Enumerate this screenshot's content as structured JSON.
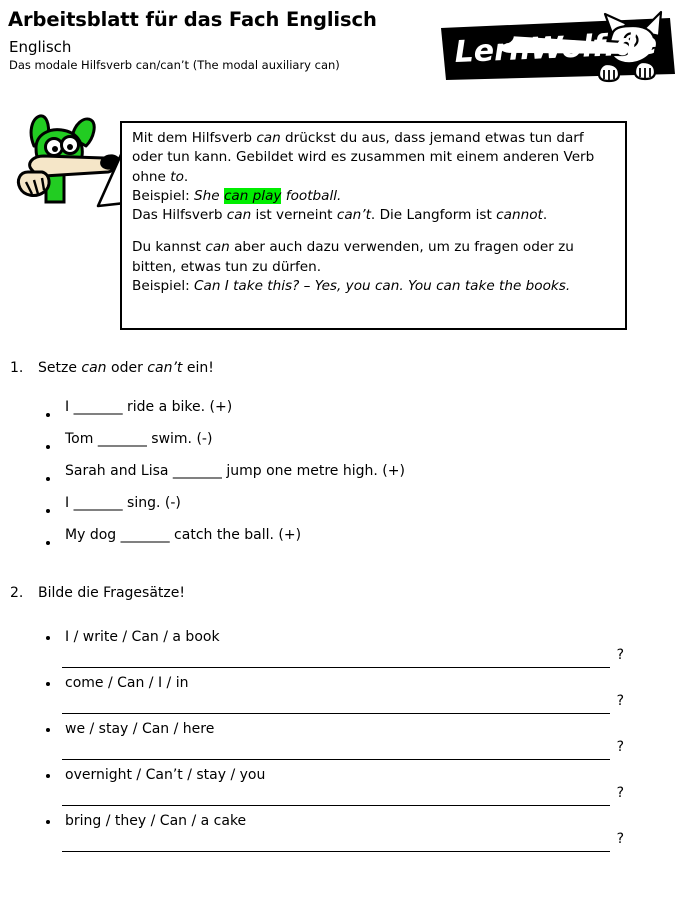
{
  "header": {
    "title": "Arbeitsblatt für das Fach Englisch",
    "subject": "Englisch",
    "topic": "Das modale Hilfsverb can/can’t (The modal auxiliary can)",
    "logo_text": "LernWolf.de",
    "logo_icon": "wolf-mascot-icon",
    "logo_bg_color": "#000000",
    "logo_text_color": "#ffffff"
  },
  "mascot": {
    "name": "green-dog-mascot-icon",
    "body_color": "#22cc22",
    "snout_color": "#f5e6c8",
    "outline_color": "#000000"
  },
  "infobox": {
    "highlight_color": "#00ee00",
    "border_color": "#000000",
    "p1_a": "Mit dem Hilfsverb ",
    "p1_can": "can",
    "p1_b": " drückst du aus, dass jemand etwas tun darf oder tun kann. Gebildet wird es zusammen mit einem anderen Verb ohne ",
    "p1_to": "to",
    "p1_c": ".",
    "p2_label": "Beispiel: ",
    "p2_she": "She ",
    "p2_highlight": "can play",
    "p2_rest": " football.",
    "p3_a": "Das Hilfsverb ",
    "p3_can": "can",
    "p3_b": " ist verneint ",
    "p3_cant": "can’t",
    "p3_c": ". Die Langform ist ",
    "p3_cannot": "cannot",
    "p3_d": ".",
    "p4_a": "Du kannst ",
    "p4_can": "can",
    "p4_b": " aber auch dazu verwenden, um zu fragen oder zu bitten, etwas tun zu dürfen.",
    "p5_label": "Beispiel: ",
    "p5_example": "Can I take this? – Yes, you can. You can take the books."
  },
  "exercise1": {
    "number": "1.",
    "title_a": "Setze ",
    "title_can": "can",
    "title_b": " oder ",
    "title_cant": "can’t",
    "title_c": " ein!",
    "items": [
      "I _______ ride a bike. (+)",
      "Tom _______ swim. (-)",
      "Sarah and Lisa _______ jump one metre high. (+)",
      "I _______ sing. (-)",
      "My dog _______ catch the ball. (+)"
    ]
  },
  "exercise2": {
    "number": "2.",
    "title": "Bilde die Fragesätze!",
    "answer_suffix": "?",
    "items": [
      " I / write / Can / a book",
      "come / Can / I / in",
      "we / stay / Can / here",
      "overnight / Can’t / stay / you",
      "bring / they / Can / a cake"
    ]
  }
}
